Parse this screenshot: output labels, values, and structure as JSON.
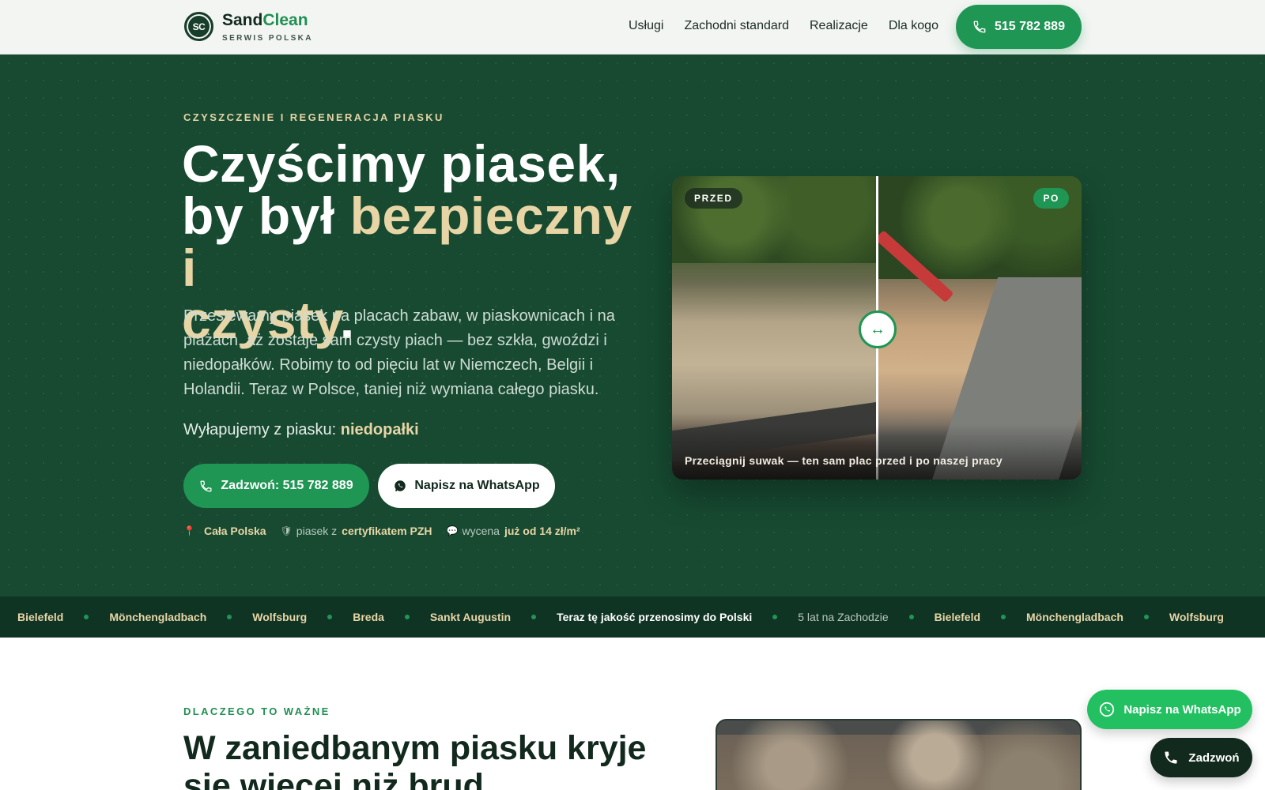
{
  "header": {
    "logo_mark": "SC",
    "brand_part1": "Sand",
    "brand_part2": "Clean",
    "brand_sub": "SERWIS POLSKA",
    "nav": [
      "Usługi",
      "Zachodni standard",
      "Realizacje",
      "Dla kogo"
    ],
    "phone": "515 782 889"
  },
  "hero": {
    "eyebrow": "CZYSZCZENIE I REGENERACJA PIASKU",
    "title_line1": "Czyścimy piasek,",
    "title_line2_start": "by był ",
    "title_line2_gold": "bezpieczny i",
    "title_line3_gold": "czysty",
    "title_line3_end": ".",
    "description": "Przesiewamy piasek na placach zabaw, w piaskownicach i na plażach, aż zostaje sam czysty piach — bez szkła, gwoździ i niedopałków. Robimy to od pięciu lat w Niemczech, Belgii i Holandii. Teraz w Polsce, taniej niż wymiana całego piasku.",
    "catch_label": "Wyłapujemy z piasku: ",
    "catch_value": "niedopałki",
    "btn_call": "Zadzwoń: 515 782 889",
    "btn_whatsapp": "Napisz na WhatsApp",
    "facts": [
      {
        "icon": "📍",
        "prefix": "",
        "value": "Cała Polska"
      },
      {
        "icon": "🛡",
        "prefix": "piasek z",
        "value": "certyfikatem PZH"
      },
      {
        "icon": "💬",
        "prefix": "wycena",
        "value": "już od 14 zł/m²"
      }
    ]
  },
  "before_after": {
    "tag_before": "PRZED",
    "tag_after": "PO",
    "caption": "Przeciągnij suwak — ten sam plac przed i po naszej pracy",
    "handle_glyph": "↔"
  },
  "ticker": {
    "items": [
      "Bielefeld",
      "Mönchengladbach",
      "Wolfsburg",
      "Breda",
      "Sankt Augustin",
      "Teraz tę jakość przenosimy do Polski",
      "5 lat na Zachodzie",
      "Bielefeld",
      "Mönchengladbach",
      "Wolfsburg"
    ]
  },
  "why": {
    "eyebrow": "DLACZEGO TO WAŻNE",
    "title": "W zaniedbanym piasku kryje się więcej niż brud"
  },
  "floating": {
    "whatsapp": "Napisz na WhatsApp",
    "call": "Zadzwoń"
  },
  "colors": {
    "hero_bg": "#174a31",
    "accent_green": "#1f9654",
    "gold": "#e8d5a6",
    "ticker_bg": "#103424"
  }
}
